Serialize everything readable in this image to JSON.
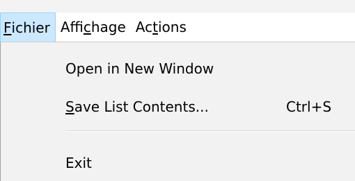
{
  "menubar": {
    "items": [
      {
        "mnemonic": "F",
        "rest": "ichier"
      },
      {
        "before": "Affi",
        "mnemonic": "c",
        "after": "hage"
      },
      {
        "before": "Ac",
        "mnemonic": "t",
        "after": "ions"
      }
    ]
  },
  "dropdown": {
    "open_in_new_window": "Open in New Window",
    "save_list": {
      "mnemonic": "S",
      "rest": "ave List Contents...",
      "shortcut": "Ctrl+S"
    },
    "exit": "Exit"
  },
  "colors": {
    "menubar_active_bg": "#cce8ff",
    "menubar_active_border": "#99d1ff",
    "dropdown_bg": "#f2f2f2"
  }
}
